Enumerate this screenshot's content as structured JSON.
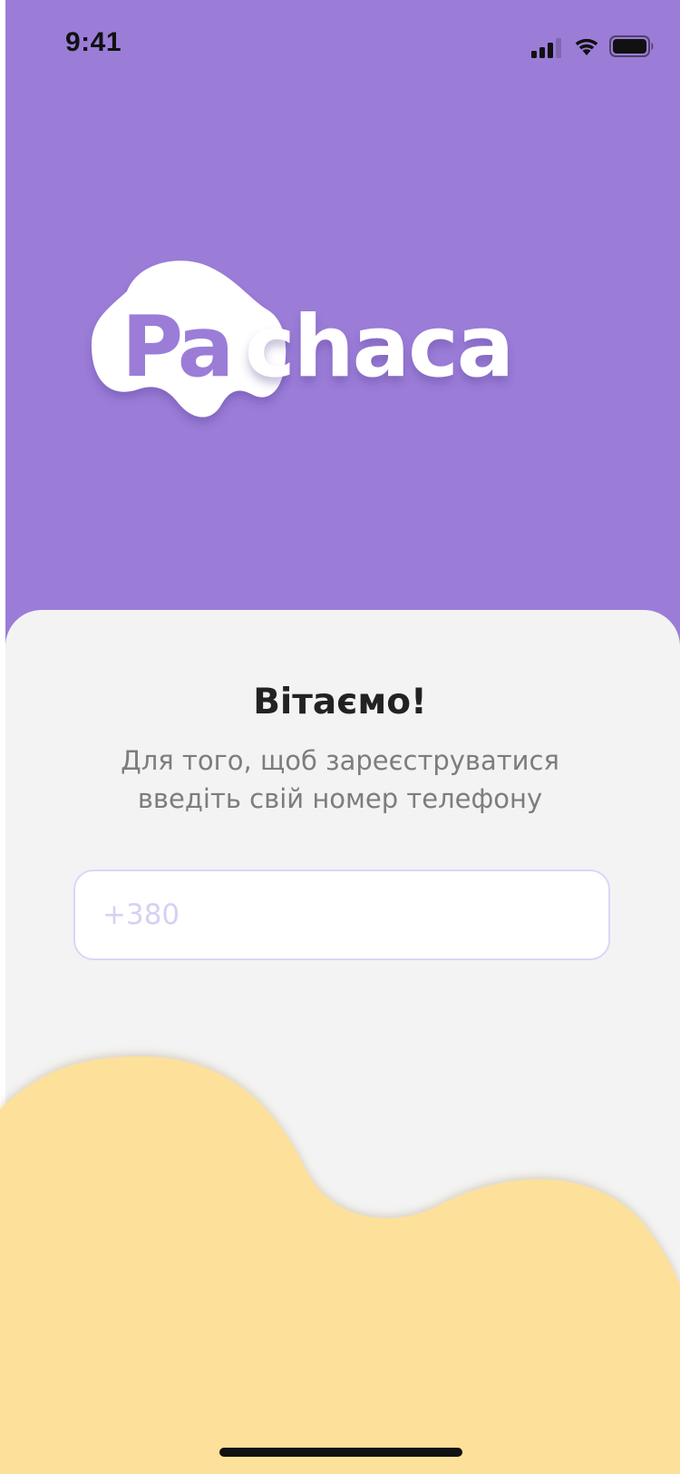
{
  "status_bar": {
    "time": "9:41"
  },
  "logo": {
    "text": "Pachaca",
    "mark_letters": "Pa",
    "word_tail": "chaca"
  },
  "welcome": {
    "title": "Вітаємо!",
    "subtitle_line1": "Для того, щоб зареєструватися",
    "subtitle_line2": "введіть свій номер телефону"
  },
  "phone_field": {
    "value": "",
    "placeholder": "+380"
  },
  "colors": {
    "hero": "#9b7dd8",
    "card": "#f3f3f3",
    "wave": "#fde09a",
    "input_border": "#ddd5f6",
    "placeholder": "#d8d0f2"
  }
}
